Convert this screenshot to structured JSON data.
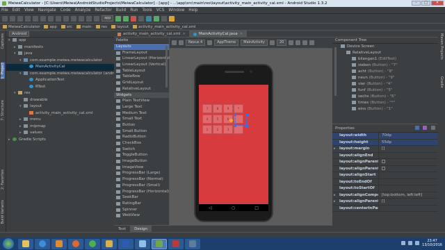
{
  "window": {
    "title": "MeiwaCalculator - [C:\\Users\\Meiwa\\AndroidStudioProjects\\MeiwaCalculator] - [app] - ...\\app\\src\\main\\res\\layout\\activity_main_activity_cal.xml - Android Studio 1.3.2"
  },
  "menu": [
    "File",
    "Edit",
    "View",
    "Navigate",
    "Code",
    "Analyze",
    "Refactor",
    "Build",
    "Run",
    "Tools",
    "VCS",
    "Window",
    "Help"
  ],
  "toolbar": {
    "run_config": "app"
  },
  "breadcrumb": [
    "MeiwaCalculator",
    "app",
    "src",
    "main",
    "res",
    "layout",
    "activity_main_activity_cal.xml"
  ],
  "left_strip": [
    "1: Project",
    "7: Structure",
    "2: Favorites",
    "Build Variants",
    "Captures"
  ],
  "right_strip": [
    "Maven Projects",
    "Gradle"
  ],
  "project": {
    "view_mode": "Android",
    "tree": [
      {
        "label": "app",
        "icon": "fold",
        "indent": 0,
        "arrow": "▾"
      },
      {
        "label": "manifests",
        "icon": "fold",
        "indent": 1,
        "arrow": "▸"
      },
      {
        "label": "java",
        "icon": "fold",
        "indent": 1,
        "arrow": "▾"
      },
      {
        "label": "com.example.meiwa.meiwacalculator",
        "icon": "pkg",
        "indent": 2,
        "arrow": "▾"
      },
      {
        "label": "MainActivityCal",
        "icon": "cls",
        "indent": 3,
        "arrow": "",
        "hl": true
      },
      {
        "label": "com.example.meiwa.meiwacalculator (androidTest)",
        "icon": "pkg",
        "indent": 2,
        "arrow": "▾"
      },
      {
        "label": "ApplicationTest",
        "icon": "cls",
        "indent": 3,
        "arrow": ""
      },
      {
        "label": "RTest",
        "icon": "cls",
        "indent": 3,
        "arrow": ""
      },
      {
        "label": "res",
        "icon": "res",
        "indent": 1,
        "arrow": "▾"
      },
      {
        "label": "drawable",
        "icon": "fold",
        "indent": 2,
        "arrow": ""
      },
      {
        "label": "layout",
        "icon": "fold",
        "indent": 2,
        "arrow": "▾"
      },
      {
        "label": "activity_main_activity_cal.xml",
        "icon": "xml",
        "indent": 3,
        "arrow": ""
      },
      {
        "label": "menu",
        "icon": "fold",
        "indent": 2,
        "arrow": "▸"
      },
      {
        "label": "mipmap",
        "icon": "fold",
        "indent": 2,
        "arrow": "▸"
      },
      {
        "label": "values",
        "icon": "fold",
        "indent": 2,
        "arrow": "▸"
      },
      {
        "label": "Gradle Scripts",
        "icon": "grd",
        "indent": 0,
        "arrow": "▸"
      }
    ]
  },
  "editor_tabs": [
    {
      "label": "activity_main_activity_cal.xml",
      "active": false
    },
    {
      "label": "MainActivityCal.java",
      "active": true
    }
  ],
  "palette": {
    "title": "Palette",
    "items": [
      {
        "label": "Layouts",
        "group": true,
        "cur": true
      },
      {
        "label": "FrameLayout"
      },
      {
        "label": "LinearLayout (Horizontal)"
      },
      {
        "label": "LinearLayout (Vertical)"
      },
      {
        "label": "TableLayout"
      },
      {
        "label": "TableRow"
      },
      {
        "label": "GridLayout"
      },
      {
        "label": "RelativeLayout"
      },
      {
        "label": "Widgets",
        "group": true
      },
      {
        "label": "Plain TextView"
      },
      {
        "label": "Large Text"
      },
      {
        "label": "Medium Text"
      },
      {
        "label": "Small Text"
      },
      {
        "label": "Button"
      },
      {
        "label": "Small Button"
      },
      {
        "label": "RadioButton"
      },
      {
        "label": "CheckBox"
      },
      {
        "label": "Switch"
      },
      {
        "label": "ToggleButton"
      },
      {
        "label": "ImageButton"
      },
      {
        "label": "ImageView"
      },
      {
        "label": "ProgressBar (Large)"
      },
      {
        "label": "ProgressBar (Normal)"
      },
      {
        "label": "ProgressBar (Small)"
      },
      {
        "label": "ProgressBar (Horizontal)"
      },
      {
        "label": "SeekBar"
      },
      {
        "label": "RatingBar"
      },
      {
        "label": "Spinner"
      },
      {
        "label": "WebView"
      }
    ]
  },
  "canvas_toolbar": {
    "device": "Nexus 4",
    "theme": "AppTheme",
    "activity": "MainActivity",
    "api": "20"
  },
  "component_tree": {
    "title": "Component Tree",
    "rows": [
      {
        "label": "Device Screen",
        "value": "",
        "indent": 0
      },
      {
        "label": "RelativeLayout",
        "value": "",
        "indent": 1
      },
      {
        "label": "bilangan1",
        "value": "(EditText)",
        "indent": 2
      },
      {
        "label": "sieben",
        "value": "(Button) - \"7\"",
        "indent": 2
      },
      {
        "label": "acht",
        "value": "(Button) - \"8\"",
        "indent": 2
      },
      {
        "label": "neun",
        "value": "(Button) - \"9\"",
        "indent": 2
      },
      {
        "label": "vier",
        "value": "(Button) - \"4\"",
        "indent": 2
      },
      {
        "label": "funf",
        "value": "(Button) - \"5\"",
        "indent": 2
      },
      {
        "label": "sechs",
        "value": "(Button) - \"6\"",
        "indent": 2
      },
      {
        "label": "times",
        "value": "(Button) - \"*\"",
        "indent": 2
      },
      {
        "label": "eins",
        "value": "(Button) - \"1\"",
        "indent": 2
      }
    ]
  },
  "properties": {
    "title": "Properties",
    "rows": [
      {
        "name": "layout:width",
        "value": "70dp",
        "sel": true
      },
      {
        "name": "layout:height",
        "value": "55dp",
        "sel": true
      },
      {
        "name": "layout:margin",
        "value": "[]",
        "exp": true
      },
      {
        "name": "layout:alignEnd",
        "value": ""
      },
      {
        "name": "layout:alignParentEnd",
        "value": "",
        "chk": true
      },
      {
        "name": "layout:alignParentStart",
        "value": "",
        "chk": true
      },
      {
        "name": "layout:alignStart",
        "value": ""
      },
      {
        "name": "layout:toEndOf",
        "value": ""
      },
      {
        "name": "layout:toStartOf",
        "value": ""
      },
      {
        "name": "layout:alignComponent",
        "value": "[top:bottom, left:left]",
        "exp": true
      },
      {
        "name": "layout:alignParent",
        "value": "[]",
        "exp": true
      },
      {
        "name": "layout:centerInParent",
        "value": ""
      }
    ]
  },
  "design_tabs": [
    "Text",
    "Design"
  ],
  "phone_buttons": [
    "7",
    "8",
    "9",
    "*",
    "4",
    "5",
    "6",
    "",
    "1",
    "2",
    "3",
    ""
  ],
  "taskbar": {
    "time": "23:47",
    "date": "13/10/2016"
  }
}
